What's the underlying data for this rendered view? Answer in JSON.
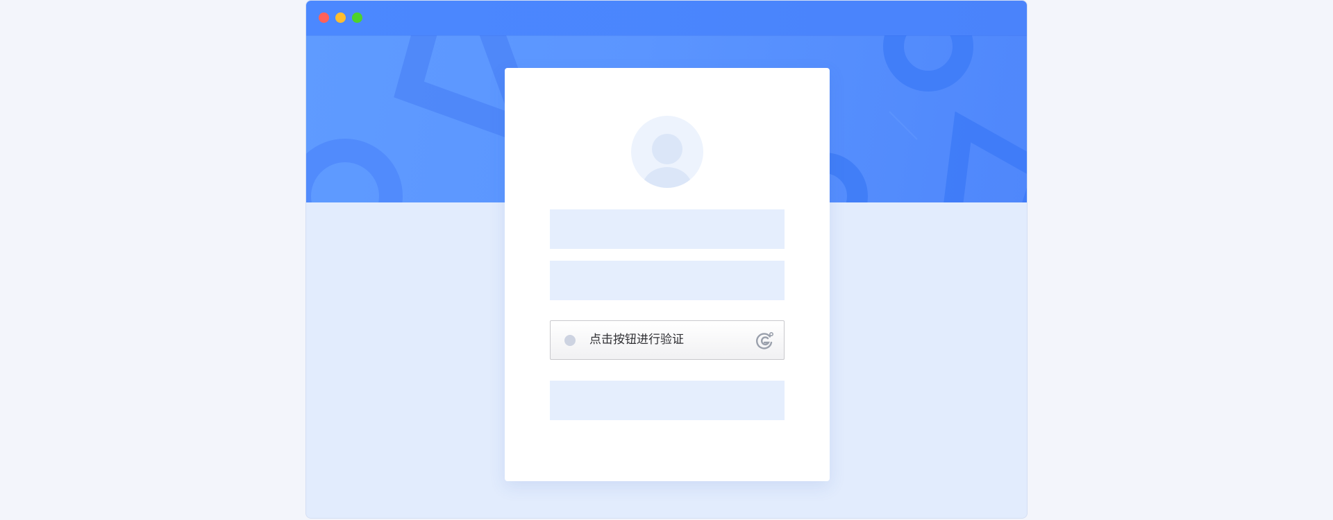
{
  "window": {
    "controls": [
      "close",
      "minimize",
      "maximize"
    ]
  },
  "login_card": {
    "avatar_icon": "user-avatar-icon",
    "captcha": {
      "label": "点击按钮进行验证",
      "logo_icon": "captcha-logo-icon"
    }
  },
  "colors": {
    "title_bar": "#4b88ff",
    "hero": "#5b95ff",
    "page_bg": "#e2ecfd",
    "placeholder": "#e5eefd",
    "traffic_close": "#ff6159",
    "traffic_min": "#ffbd2e",
    "traffic_max": "#4dd22b"
  }
}
